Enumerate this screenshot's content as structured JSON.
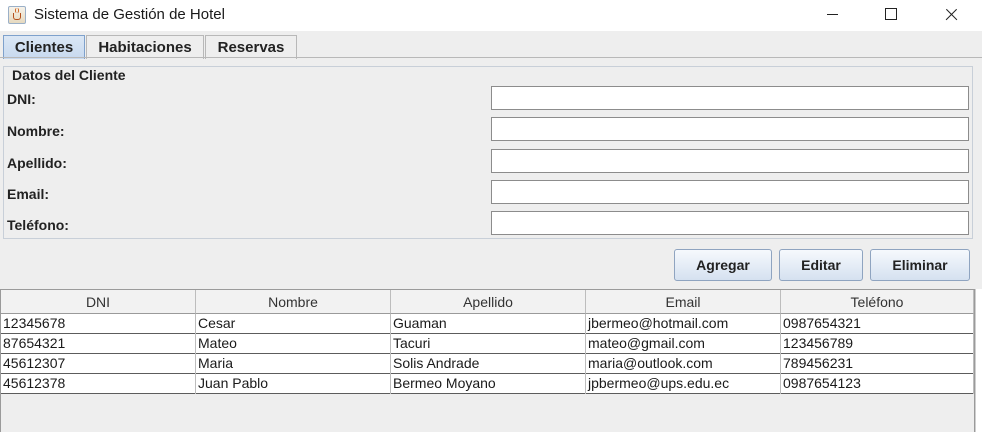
{
  "window": {
    "title": "Sistema de Gestión de Hotel",
    "icon": "java-cup-icon"
  },
  "tabs": [
    {
      "label": "Clientes",
      "active": true
    },
    {
      "label": "Habitaciones",
      "active": false
    },
    {
      "label": "Reservas",
      "active": false
    }
  ],
  "form": {
    "legend": "Datos del Cliente",
    "fields": [
      {
        "label": "DNI:",
        "value": ""
      },
      {
        "label": "Nombre:",
        "value": ""
      },
      {
        "label": "Apellido:",
        "value": ""
      },
      {
        "label": "Email:",
        "value": ""
      },
      {
        "label": "Teléfono:",
        "value": ""
      }
    ]
  },
  "actions": {
    "add_label": "Agregar",
    "edit_label": "Editar",
    "delete_label": "Eliminar"
  },
  "table": {
    "columns": [
      "DNI",
      "Nombre",
      "Apellido",
      "Email",
      "Teléfono"
    ],
    "rows": [
      [
        "12345678",
        "Cesar",
        "Guaman",
        "jbermeo@hotmail.com",
        "0987654321"
      ],
      [
        "87654321",
        "Mateo",
        "Tacuri",
        "mateo@gmail.com",
        "123456789"
      ],
      [
        "45612307",
        "Maria",
        "Solis Andrade",
        "maria@outlook.com",
        "789456231"
      ],
      [
        "45612378",
        "Juan Pablo",
        "Bermeo Moyano",
        "jpbermeo@ups.edu.ec",
        "0987654123"
      ]
    ]
  }
}
